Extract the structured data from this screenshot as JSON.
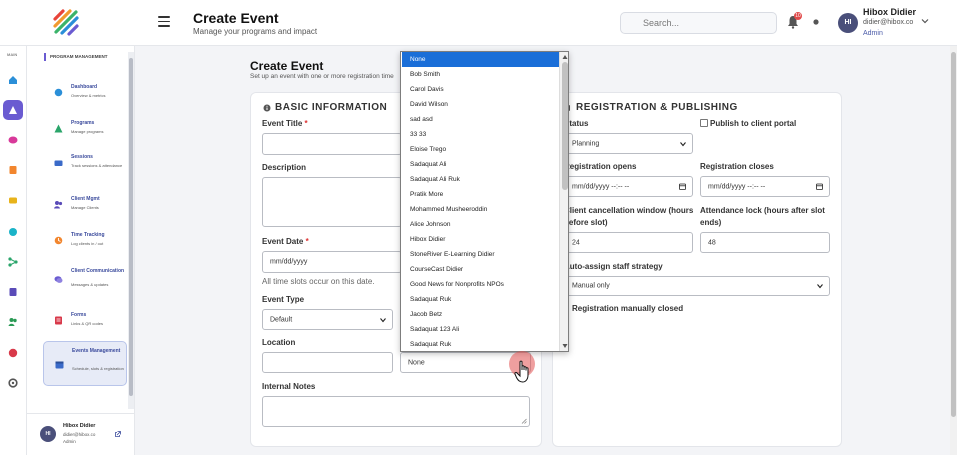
{
  "header": {
    "title": "Create Event",
    "subtitle": "Manage your programs and impact",
    "search_placeholder": "Search...",
    "notif_count": "10",
    "user_initials": "HI",
    "user_name": "Hibox Didier",
    "user_email": "didier@hibox.co",
    "user_role": "Admin"
  },
  "rail": {
    "label": "MAIN"
  },
  "sidebar": {
    "section": "PROGRAM MANAGEMENT",
    "items": [
      {
        "title": "Dashboard",
        "sub": "Overview & metrics"
      },
      {
        "title": "Programs",
        "sub": "Manage programs"
      },
      {
        "title": "Sessions",
        "sub": "Track sessions & attendance"
      },
      {
        "title": "Client Mgmt",
        "sub": "Manage Clients"
      },
      {
        "title": "Time Tracking",
        "sub": "Log clients in / out"
      },
      {
        "title": "Client Communication",
        "sub": "Messages & updates"
      },
      {
        "title": "Forms",
        "sub": "Links & QR codes"
      },
      {
        "title": "Events Management",
        "sub": "Schedule, slots & registration"
      }
    ],
    "footer": {
      "initials": "HI",
      "name": "Hibox Didier",
      "email": "didier@hibox.co",
      "role": "Admin"
    }
  },
  "page": {
    "title": "Create Event",
    "subtitle": "Set up an event with one or more registration time"
  },
  "basic": {
    "heading": "BASIC INFORMATION",
    "event_title_label": "Event Title",
    "req": "*",
    "description_label": "Description",
    "event_date_label": "Event Date",
    "event_date_placeholder": "mm/dd/yyyy",
    "event_date_hint": "All time slots occur on this date.",
    "event_type_label": "Event Type",
    "event_type_value": "Default",
    "location_label": "Location",
    "assignee_value": "None",
    "internal_notes_label": "Internal Notes"
  },
  "registration": {
    "heading": "REGISTRATION & PUBLISHING",
    "status_label": "Status",
    "status_value": "Planning",
    "publish_label": "Publish to client portal",
    "opens_label": "Registration opens",
    "opens_placeholder": "mm/dd/yyyy --:-- --",
    "closes_label": "Registration closes",
    "closes_placeholder": "mm/dd/yyyy --:-- --",
    "cancel_label_1": "Client cancellation window (hours",
    "cancel_label_2": "before slot)",
    "cancel_value": "24",
    "lock_label_1": "Attendance lock (hours after slot",
    "lock_label_2": "ends)",
    "lock_value": "48",
    "auto_assign_label": "Auto-assign staff strategy",
    "auto_assign_value": "Manual only",
    "manual_closed_label": "Registration manually closed"
  },
  "dropdown": {
    "options": [
      "None",
      "Bob Smith",
      "Carol Davis",
      "David Wilson",
      "sad asd",
      "33 33",
      "Eloise Trego",
      "Sadaquat Ali",
      "Sadaquat Ali Ruk",
      "Pratik More",
      "Mohammed Musheeroddin",
      "Alice Johnson",
      "Hibox Didier",
      "StoneRiver E-Learning Didier",
      "CourseCast Didier",
      "Good News for Nonprofits NPOs",
      "Sadaquat Ruk",
      "Jacob Betz",
      "Sadaquat 123 Ali",
      "Sadaquat Ruk"
    ],
    "selected_index": 0
  },
  "colors": {
    "accent": "#6a5bd1",
    "link": "#3a4a9c",
    "selection": "#1a6ed8"
  }
}
